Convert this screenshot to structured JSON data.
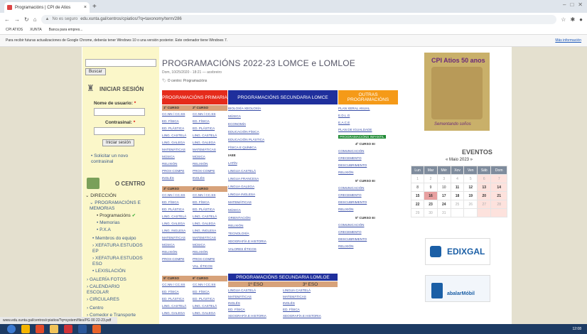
{
  "browser": {
    "tab_title": "Programacións | CPI de Atios",
    "url": "edu.xunta.gal/centros/cpiatios/?q=taxonomy/term/286",
    "insecure_label": "No es seguro",
    "bookmarks": [
      "CPI ATIOS",
      "XUNTA",
      "Banca para empres..."
    ],
    "info_message": "Para recibir futuras actualizaciones de Google Chrome, deberás tener Windows 10 o una versión posterior. Este ordenador tiene Windows 7.",
    "info_link": "Más información"
  },
  "sidebar": {
    "search_button": "Buscar",
    "login_heading": "INICIAR SESIÓN",
    "username_label": "Nome de usuario:",
    "password_label": "Contrasinal:",
    "required_mark": "*",
    "login_button": "Iniciar sesión",
    "request_link": "Solicitar un novo contrasinal",
    "centro_heading": "O CENTRO",
    "nav": [
      "DIRECCIÓN",
      "PROGRAMACIÓNS E MEMORIAS",
      "Programacións",
      "Memorias",
      "P.X.A",
      "Membros do equipo",
      "XEFATURA ESTUDOS EP",
      "XEFATURA ESTUDOS ESO",
      "LEXISLACIÓN",
      "GALERÍA FOTOS",
      "CALENDARIO ESCOLAR",
      "CIRCULARES",
      "Centro",
      "Comedor e Transporte"
    ]
  },
  "main": {
    "title": "PROGRAMACIÓNS 2022-23 LOMCE e LOMLOE",
    "date": "Dom, 10/25/2020 - 18:21 — acebreiro",
    "category_prefix": "O centro:",
    "category": "Programacións",
    "headers": {
      "primaria": "PROGRAMACIÓNS PRIMARIA",
      "secundaria_lomce": "PROGRAMACIÓNS SECUNDARIA LOMCE",
      "outras": "OUTRAS PROGRAMACIÓNS",
      "secundaria_lomloe": "PROGRAMACIÓNS SECUNDARIA LOMLOE"
    },
    "primaria_courses": [
      "1º CURSO",
      "2º CURSO",
      "3º CURSO",
      "4º CURSO",
      "5º CURSO",
      "6º CURSO"
    ],
    "primaria_subjects": [
      "CC.NN / CC.SS",
      "ED. FÍSICA",
      "ED. PLÁSTICA",
      "LING. CASTELÁ",
      "LING. GALEGA",
      "MATEMÁTICAS",
      "MÚSICA",
      "RELIXIÓN",
      "PROX-COMPE",
      "INGLÉS"
    ],
    "primaria_subjects_b": [
      "CC.NN / CC.SS",
      "ED. FÍSICA",
      "ED. PLÁSTICA",
      "LING. CASTELÁ",
      "LING. GALEGA",
      "LING. INGLESA",
      "MATEMÁTICAS",
      "MÚSICA",
      "RELIXIÓN",
      "PROX-COMPE"
    ],
    "primaria_extra": "VAL. ÉTICOS",
    "secundaria_lomce": [
      "BIOLOXÍA-XEOLOXÍA",
      "MÚSICA",
      "ECONOMÍA",
      "EDUCACIÓN FÍSICA",
      "EDUCACIÓN PLÁSTICA",
      "FÍSICA E QUÍMICA",
      "IAEE",
      "LATÍN",
      "LINGUA CASTELÁ",
      "LINGUA FRANCESA",
      "LINGUA GALEGA",
      "LINGUA INGLESA",
      "MATEMÁTICAS",
      "MÚSICA",
      "ORIENTACIÓN",
      "RELIXIÓN",
      "TECNOLOXÍA",
      "XEOGRAFÍA E HISTORIA",
      "VALORES ÉTICOS"
    ],
    "outras": [
      "PLAN XERAL ANUAL",
      "E.D.L.G",
      "E.A.C.E",
      "PLAN DE IGUALDADE"
    ],
    "infantil": "PROGRAMACIÓNS INFANTIL",
    "infantil_blocks": [
      {
        "title": "4º CURSO EI",
        "items": [
          "COMUNICACIÓN",
          "CRECEMENTO",
          "DESCUBRIMENTO",
          "RELIXIÓN"
        ]
      },
      {
        "title": "5º CURSO EI",
        "items": [
          "COMUNICACIÓN",
          "CRECEMENTO",
          "DESCUBRIMENTO",
          "RELIXIÓN"
        ]
      },
      {
        "title": "5º CURSO EI",
        "items": [
          "COMUNICACIÓN",
          "CRECEMENTO",
          "DESCUBRIMENTO",
          "RELIXIÓN"
        ]
      }
    ],
    "lomloe_cols": [
      "1º ESO",
      "3º ESO"
    ],
    "lomloe_1": [
      "LINGUA CASTELÁ",
      "MATEMÁTICAS",
      "INGLÉS",
      "ED. FÍSICA",
      "XEOGRAFÍA E HISTORIA"
    ],
    "lomloe_3": [
      "LINGUA CASTELÁ",
      "MATEMÁTICAS",
      "INGLÉS",
      "ED. FÍSICA",
      "XEOGRAFÍA E HISTORIA"
    ]
  },
  "right": {
    "cover_title": "CPI Atios 50 anos",
    "cover_caption": "Sementando soños",
    "events_heading": "EVENTOS",
    "month": "« Maio 2023 »",
    "weekdays": [
      "Lun",
      "Mar",
      "Mér",
      "Xov",
      "Ven",
      "Sáb",
      "Dom"
    ],
    "weeks": [
      [
        "1",
        "2",
        "3",
        "4",
        "5",
        "6",
        "7"
      ],
      [
        "8",
        "9",
        "10",
        "11",
        "12",
        "13",
        "14"
      ],
      [
        "15",
        "16",
        "17",
        "18",
        "19",
        "20",
        "21"
      ],
      [
        "22",
        "23",
        "24",
        "25",
        "26",
        "27",
        "28"
      ],
      [
        "29",
        "30",
        "31",
        "",
        "",
        "",
        ""
      ]
    ],
    "edixgal": "EDIXGAL",
    "abalar": "abalarMóbil"
  },
  "status_url": "www.edu.xunta.gal/centros/cpiatios/?q=system/files/PG 00 22-23.pdf",
  "clock": "12:08"
}
